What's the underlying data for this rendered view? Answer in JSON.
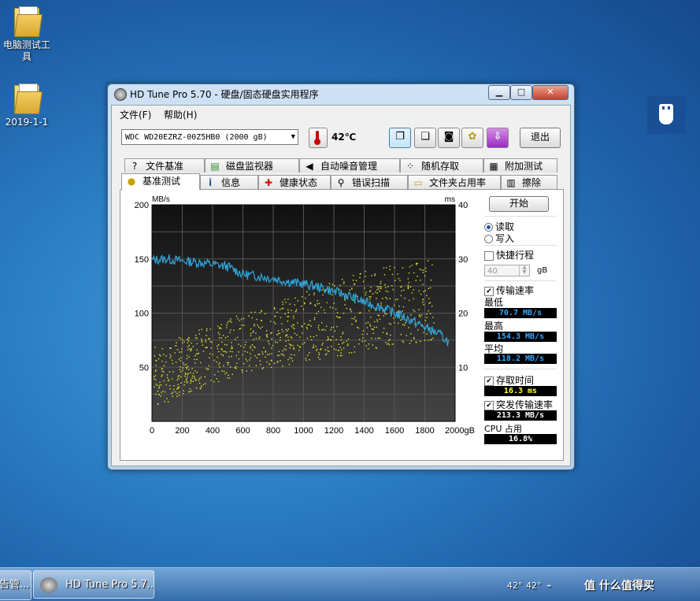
{
  "desktop": {
    "icons": [
      {
        "label": "电脑测试工具"
      },
      {
        "label": "2019-1-1"
      }
    ]
  },
  "window": {
    "title": "HD Tune Pro 5.70 - 硬盘/固态硬盘实用程序",
    "controls": {
      "minimize": "▁",
      "maximize": "□",
      "close": "✕"
    },
    "menu": [
      "文件(F)",
      "帮助(H)"
    ],
    "drive": "WDC WD20EZRZ-00Z5HB0 (2000 gB)",
    "temperature": "42℃",
    "exit_label": "退出",
    "tabs_row1": [
      {
        "label": "文件基准",
        "icon": "file-benchmark-icon",
        "glyph": "?"
      },
      {
        "label": "磁盘监视器",
        "icon": "disk-monitor-icon",
        "glyph": "▤"
      },
      {
        "label": "自动噪音管理",
        "icon": "speaker-icon",
        "glyph": "◀"
      },
      {
        "label": "随机存取",
        "icon": "random-access-icon",
        "glyph": "⁘"
      },
      {
        "label": "附加测试",
        "icon": "extra-tests-icon",
        "glyph": "▦"
      }
    ],
    "tabs_row2": [
      {
        "label": "基准测试",
        "icon": "benchmark-icon",
        "glyph": "●"
      },
      {
        "label": "信息",
        "icon": "info-icon",
        "glyph": "i"
      },
      {
        "label": "健康状态",
        "icon": "health-cross-icon",
        "glyph": "✚"
      },
      {
        "label": "错误扫描",
        "icon": "magnifier-icon",
        "glyph": "⚲"
      },
      {
        "label": "文件夹占用率",
        "icon": "folder-icon",
        "glyph": "▭"
      },
      {
        "label": "擦除",
        "icon": "trash-icon",
        "glyph": "▥"
      }
    ],
    "side": {
      "start_label": "开始",
      "read_label": "读取",
      "write_label": "写入",
      "short_stroke_label": "快捷行程",
      "short_stroke_value": "40",
      "short_stroke_unit": "gB",
      "transfer_rate_label": "传输速率",
      "min_label": "最低",
      "min_value": "70.7 MB/s",
      "max_label": "最高",
      "max_value": "154.3 MB/s",
      "avg_label": "平均",
      "avg_value": "118.2 MB/s",
      "access_time_label": "存取时间",
      "access_time_value": "16.3 ms",
      "burst_label": "突发传输速率",
      "burst_value": "213.3 MB/s",
      "cpu_label": "CPU 占用",
      "cpu_value": "16.8%"
    }
  },
  "chart_data": {
    "type": "line",
    "title": "",
    "y_left_label": "MB/s",
    "y_right_label": "ms",
    "xlim": [
      0,
      2000
    ],
    "ylim_left": [
      0,
      200
    ],
    "ylim_right": [
      0,
      40
    ],
    "x_ticks": [
      "0",
      "200",
      "400",
      "600",
      "800",
      "1000",
      "1200",
      "1400",
      "1600",
      "1800",
      "2000gB"
    ],
    "y_left_ticks": [
      "200",
      "150",
      "100",
      "50"
    ],
    "y_right_ticks": [
      "40",
      "30",
      "20",
      "10"
    ],
    "grid": true,
    "colors": {
      "transfer": "#2fa9e0",
      "access": "#e8e830",
      "background": "#262626"
    },
    "series": [
      {
        "x": [
          0,
          100,
          200,
          300,
          400,
          500,
          600,
          700,
          800,
          900,
          1000,
          1100,
          1200,
          1300,
          1400,
          1500,
          1600,
          1700,
          1800,
          1900,
          1960
        ],
        "values": [
          149,
          150,
          148,
          147,
          145,
          143,
          136,
          134,
          132,
          129,
          127,
          124,
          120,
          116,
          110,
          106,
          100,
          94,
          87,
          80,
          73
        ]
      }
    ],
    "access_scatter": {
      "units": "ms",
      "x": [
        50,
        200,
        400,
        600,
        800,
        1000,
        1200,
        1400,
        1600,
        1800
      ],
      "min": [
        3,
        5,
        7,
        9,
        10,
        11,
        12,
        13,
        14,
        15
      ],
      "max": [
        14,
        16,
        18,
        20,
        22,
        24,
        26,
        28,
        29,
        30
      ]
    }
  },
  "taskbar": {
    "left_label": "告管...",
    "app_label": "HD Tune Pro 5.7...",
    "temp1": "42°",
    "temp2": "42°",
    "watermark": "值 什么值得买"
  }
}
